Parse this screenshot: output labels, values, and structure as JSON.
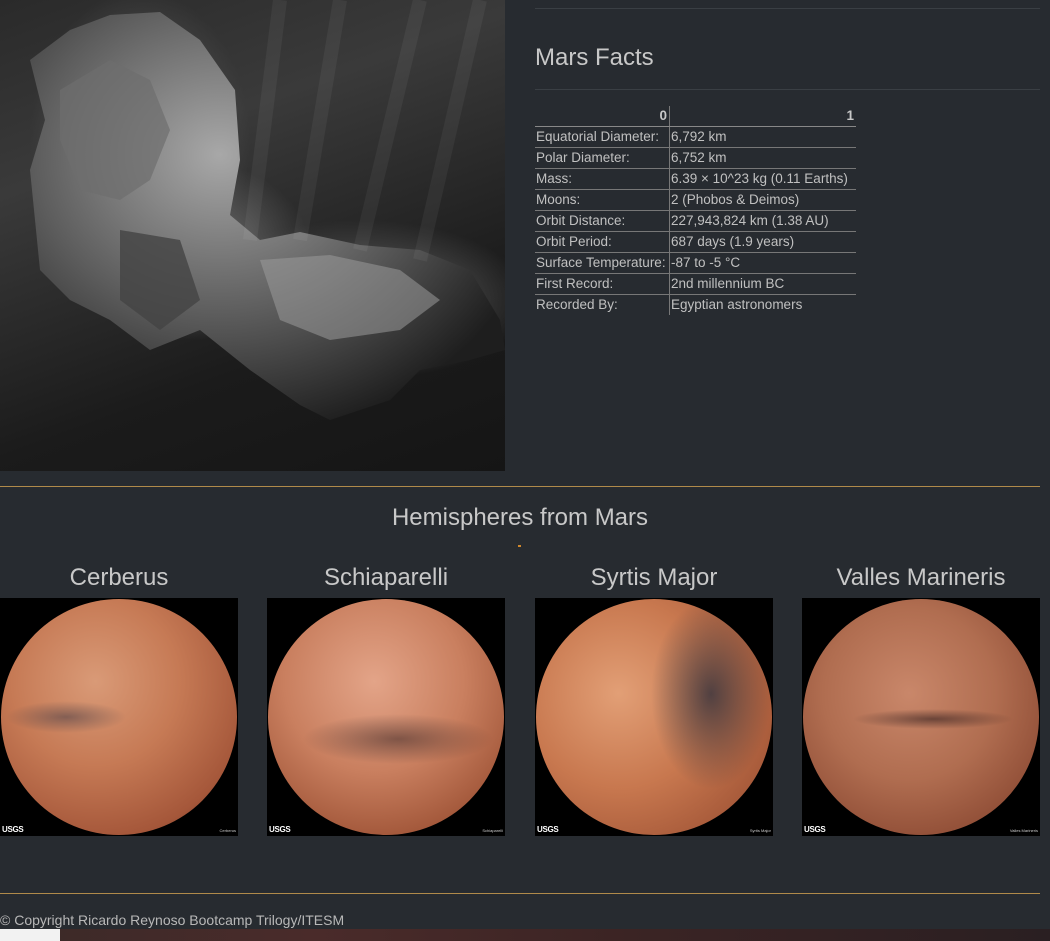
{
  "featured": {
    "image_name": "comet-nucleus-grayscale-image"
  },
  "facts": {
    "title": "Mars Facts",
    "headers": [
      "0",
      "1"
    ],
    "rows": [
      {
        "label": "Equatorial Diameter:",
        "value": "6,792 km"
      },
      {
        "label": "Polar Diameter:",
        "value": "6,752 km"
      },
      {
        "label": "Mass:",
        "value": "6.39 × 10^23 kg (0.11 Earths)"
      },
      {
        "label": "Moons:",
        "value": "2 (Phobos & Deimos)"
      },
      {
        "label": "Orbit Distance:",
        "value": "227,943,824 km (1.38 AU)"
      },
      {
        "label": "Orbit Period:",
        "value": "687 days (1.9 years)"
      },
      {
        "label": "Surface Temperature:",
        "value": "-87 to -5 °C"
      },
      {
        "label": "First Record:",
        "value": "2nd millennium BC"
      },
      {
        "label": "Recorded By:",
        "value": "Egyptian astronomers"
      }
    ]
  },
  "hemispheres": {
    "title": "Hemispheres from Mars",
    "items": [
      {
        "name": "Cerberus",
        "logo": "USGS",
        "credit": "Cerberus"
      },
      {
        "name": "Schiaparelli",
        "logo": "USGS",
        "credit": "Schiaparelli"
      },
      {
        "name": "Syrtis Major",
        "logo": "USGS",
        "credit": "Syrtis Major"
      },
      {
        "name": "Valles Marineris",
        "logo": "USGS",
        "credit": "Valles Marineris"
      }
    ]
  },
  "colors": {
    "background": "#272b30",
    "accent_rule": "#b08a4a",
    "text": "#c8c8c8"
  },
  "footer": {
    "text": "© Copyright Ricardo Reynoso Bootcamp Trilogy/ITESM"
  }
}
